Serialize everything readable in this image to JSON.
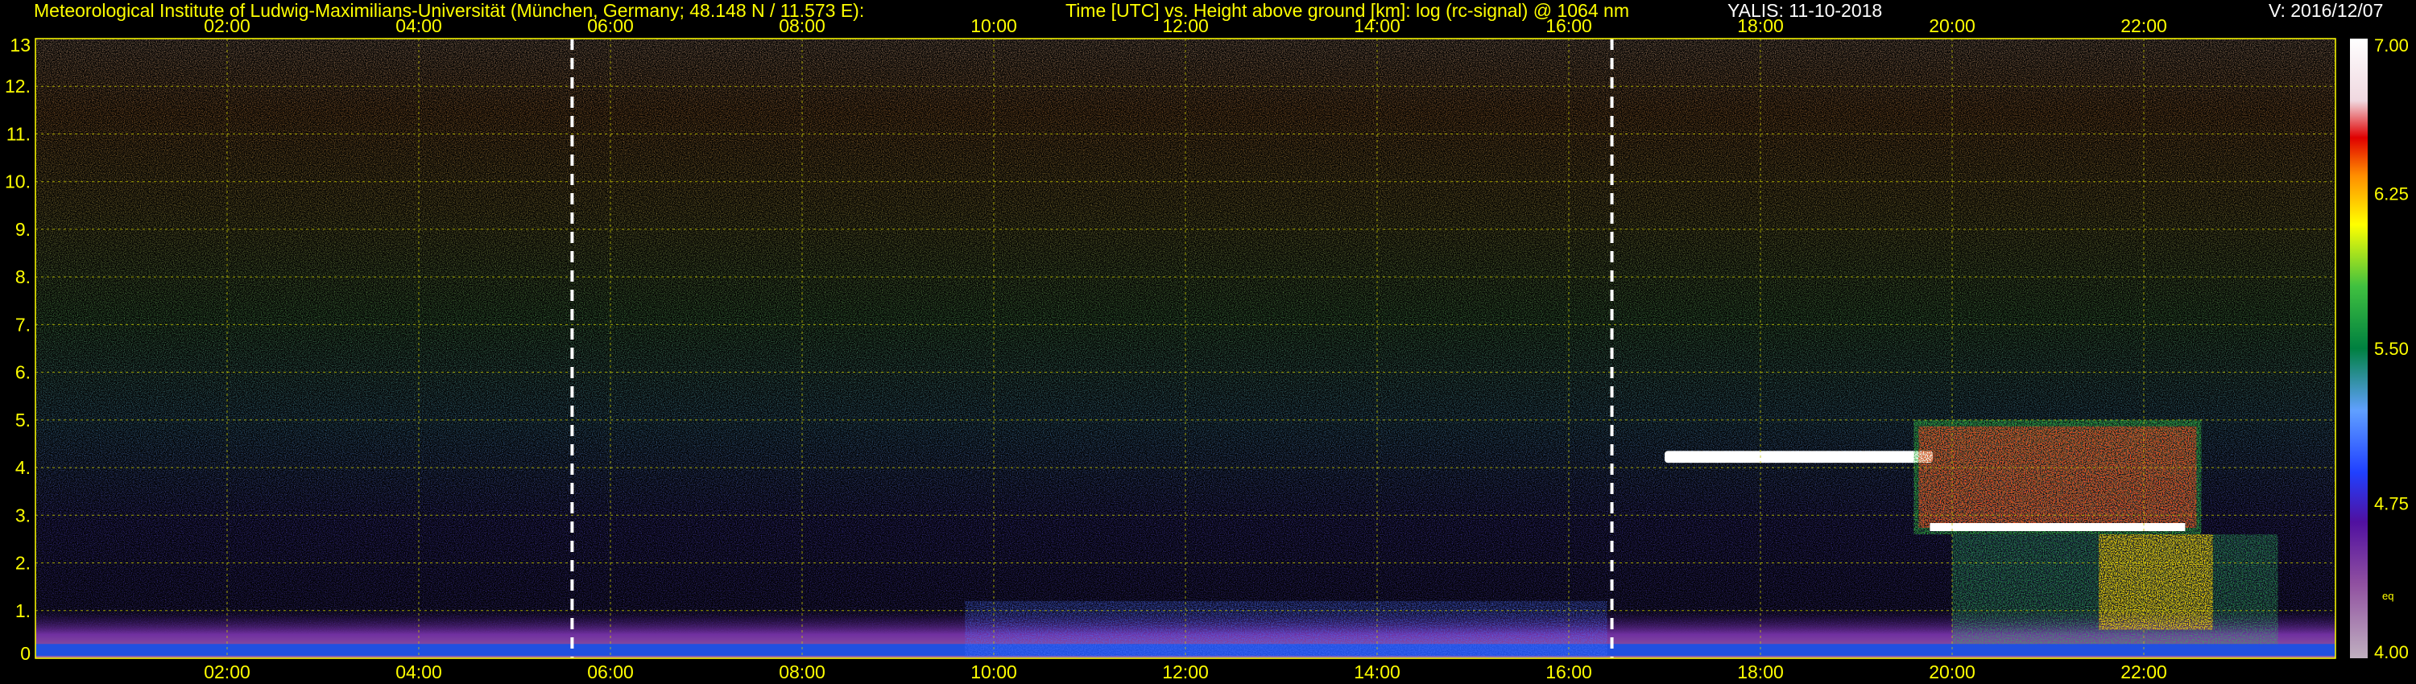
{
  "header": {
    "institute": "Meteorological Institute of Ludwig-Maximilians-Universität (München, Germany; 48.148 N / 11.573 E):",
    "plot_title": "Time [UTC] vs. Height above ground [km]: log (rc-signal) @ 1064 nm",
    "instrument": "YALIS: 11-10-2018",
    "version": "V: 2016/12/07"
  },
  "colorbar": {
    "ticks": [
      "7.00",
      "6.25",
      "5.50",
      "4.75",
      "4.00"
    ],
    "extra_label": "eq"
  },
  "colors": {
    "text": "#ffff00",
    "grid": "#c8c800",
    "marker_lines": "#ffffff"
  },
  "chart_data": {
    "type": "heatmap",
    "title": "Time [UTC] vs. Height above ground [km]: log (rc-signal) @ 1064 nm",
    "xlabel": "Time [UTC]",
    "ylabel": "Height above ground [km]",
    "x_ticks": [
      "02:00",
      "04:00",
      "06:00",
      "08:00",
      "10:00",
      "12:00",
      "14:00",
      "16:00",
      "18:00",
      "20:00",
      "22:00"
    ],
    "x_tick_hours": [
      2,
      4,
      6,
      8,
      10,
      12,
      14,
      16,
      18,
      20,
      22
    ],
    "xlim_hours": [
      0.0,
      24.0
    ],
    "y_ticks": [
      "0",
      "1.",
      "2.",
      "3.",
      "4.",
      "5.",
      "6.",
      "7.",
      "8.",
      "9.",
      "10.",
      "11.",
      "12.",
      "13"
    ],
    "ylim_km": [
      0,
      13
    ],
    "colorscale_range": [
      4.0,
      7.0
    ],
    "colorscale_ticks": [
      7.0,
      6.25,
      5.5,
      4.75,
      4.0
    ],
    "grid": true,
    "dashed_markers_hours": [
      5.6,
      16.45
    ],
    "features": [
      {
        "kind": "boundary_layer_aerosol",
        "from_hour": 0.0,
        "to_hour": 24.0,
        "top_km": 1.0,
        "value": 5.2
      },
      {
        "kind": "daytime_mixing_layer",
        "from_hour": 9.7,
        "to_hour": 16.4,
        "top_km": 1.2,
        "value": 5.4
      },
      {
        "kind": "cloud_layer",
        "from_hour": 17.0,
        "to_hour": 19.8,
        "base_km": 4.1,
        "top_km": 4.35,
        "value": 7.0
      },
      {
        "kind": "cloud_layer",
        "from_hour": 19.6,
        "to_hour": 22.6,
        "base_km": 2.6,
        "top_km": 5.0,
        "value": 6.6
      },
      {
        "kind": "precipitation_fall_streaks",
        "from_hour": 20.0,
        "to_hour": 23.4,
        "base_km": 0.3,
        "top_km": 2.6,
        "value": 6.3
      }
    ]
  }
}
